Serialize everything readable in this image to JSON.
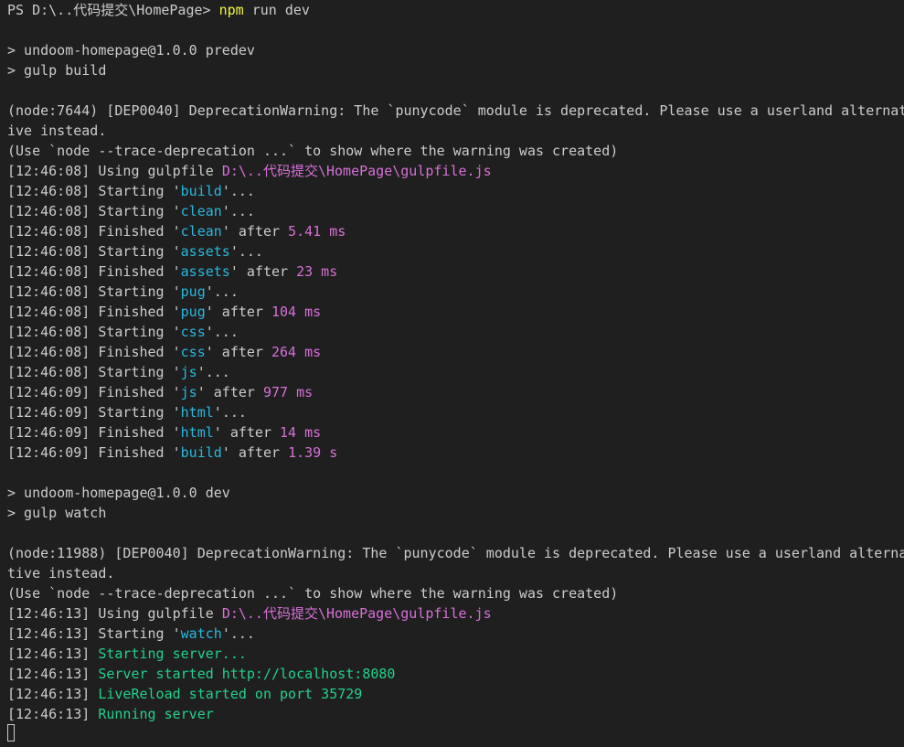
{
  "prompt": {
    "ps": "PS D:\\..代码提交\\HomePage> ",
    "cmd": "npm",
    "args": " run dev"
  },
  "section1": {
    "pre1": "> undoom-homepage@1.0.0 predev",
    "pre2": "> gulp build",
    "warn1": "(node:7644) [DEP0040] DeprecationWarning: The `punycode` module is deprecated. Please use a userland alternat",
    "warn2": "ive instead.",
    "warn3": "(Use `node --trace-deprecation ...` to show where the warning was created)",
    "using_ts": "[12:46:08]",
    "using_label": " Using gulpfile ",
    "using_path": "D:\\..代码提交\\HomePage\\gulpfile.js",
    "tasks": [
      {
        "ts": "[12:46:08]",
        "verb": "Starting",
        "name": "build",
        "after": "",
        "dur": ""
      },
      {
        "ts": "[12:46:08]",
        "verb": "Starting",
        "name": "clean",
        "after": "",
        "dur": ""
      },
      {
        "ts": "[12:46:08]",
        "verb": "Finished",
        "name": "clean",
        "after": " after ",
        "dur": "5.41 ms"
      },
      {
        "ts": "[12:46:08]",
        "verb": "Starting",
        "name": "assets",
        "after": "",
        "dur": ""
      },
      {
        "ts": "[12:46:08]",
        "verb": "Finished",
        "name": "assets",
        "after": " after ",
        "dur": "23 ms"
      },
      {
        "ts": "[12:46:08]",
        "verb": "Starting",
        "name": "pug",
        "after": "",
        "dur": ""
      },
      {
        "ts": "[12:46:08]",
        "verb": "Finished",
        "name": "pug",
        "after": " after ",
        "dur": "104 ms"
      },
      {
        "ts": "[12:46:08]",
        "verb": "Starting",
        "name": "css",
        "after": "",
        "dur": ""
      },
      {
        "ts": "[12:46:08]",
        "verb": "Finished",
        "name": "css",
        "after": " after ",
        "dur": "264 ms"
      },
      {
        "ts": "[12:46:08]",
        "verb": "Starting",
        "name": "js",
        "after": "",
        "dur": ""
      },
      {
        "ts": "[12:46:09]",
        "verb": "Finished",
        "name": "js",
        "after": " after ",
        "dur": "977 ms"
      },
      {
        "ts": "[12:46:09]",
        "verb": "Starting",
        "name": "html",
        "after": "",
        "dur": ""
      },
      {
        "ts": "[12:46:09]",
        "verb": "Finished",
        "name": "html",
        "after": " after ",
        "dur": "14 ms"
      },
      {
        "ts": "[12:46:09]",
        "verb": "Finished",
        "name": "build",
        "after": " after ",
        "dur": "1.39 s"
      }
    ]
  },
  "section2": {
    "pre1": "> undoom-homepage@1.0.0 dev",
    "pre2": "> gulp watch",
    "warn1": "(node:11988) [DEP0040] DeprecationWarning: The `punycode` module is deprecated. Please use a userland alterna",
    "warn2": "tive instead.",
    "warn3": "(Use `node --trace-deprecation ...` to show where the warning was created)",
    "using_ts": "[12:46:13]",
    "using_label": " Using gulpfile ",
    "using_path": "D:\\..代码提交\\HomePage\\gulpfile.js",
    "watch_ts": "[12:46:13]",
    "watch_verb": "Starting",
    "watch_name": "watch",
    "server": [
      {
        "ts": "[12:46:13]",
        "text": "Starting server..."
      },
      {
        "ts": "[12:46:13]",
        "text": "Server started http://localhost:8080"
      },
      {
        "ts": "[12:46:13]",
        "text": "LiveReload started on port 35729"
      },
      {
        "ts": "[12:46:13]",
        "text": "Running server"
      }
    ]
  },
  "colors": {
    "background": "#1f1f1f",
    "text": "#cccccc",
    "task_name": "#29b8db",
    "path_duration": "#d670d6",
    "server": "#23d18b",
    "command": "#f5f543"
  }
}
